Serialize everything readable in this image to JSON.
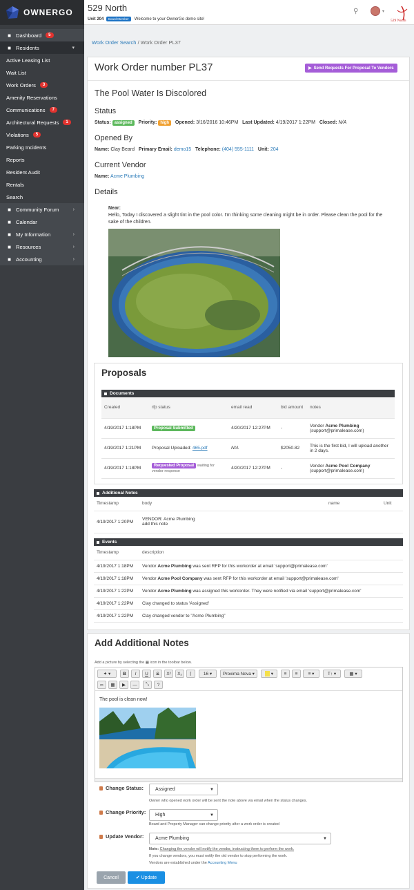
{
  "brand": {
    "name": "OWNERGO"
  },
  "sidebar": {
    "items": [
      {
        "label": "Dashboard",
        "icon": "dashboard-icon",
        "badge": "5"
      },
      {
        "label": "Residents",
        "icon": "user-icon",
        "chevron": true
      },
      {
        "label": "Active Leasing List"
      },
      {
        "label": "Wait List"
      },
      {
        "label": "Work Orders",
        "badge": "3"
      },
      {
        "label": "Amenity Reservations"
      },
      {
        "label": "Communications",
        "badge": "7"
      },
      {
        "label": "Architectural Requests",
        "badge": "1"
      },
      {
        "label": "Violations",
        "badge": "5"
      },
      {
        "label": "Parking Incidents"
      },
      {
        "label": "Reports"
      },
      {
        "label": "Resident Audit"
      },
      {
        "label": "Rentals"
      },
      {
        "label": "Search"
      },
      {
        "label": "Community Forum",
        "icon": "chat-icon",
        "chevron": true
      },
      {
        "label": "Calendar",
        "icon": "calendar-icon"
      },
      {
        "label": "My Information",
        "icon": "person-icon",
        "chevron": true
      },
      {
        "label": "Resources",
        "icon": "folder-icon",
        "chevron": true
      },
      {
        "label": "Accounting",
        "icon": "money-icon",
        "chevron": true
      }
    ]
  },
  "header": {
    "property": "529 North",
    "unit": "Unit 204",
    "role_badge": "Board Member",
    "welcome": "Welcome to your OwnerGo demo site!",
    "brand_small": "529 North"
  },
  "breadcrumb": {
    "parent": "Work Order Search",
    "sep": "/",
    "current": "Work Order PL37"
  },
  "workorder": {
    "title": "Work Order number PL37",
    "send_button": "Send Requests For Proposal To Vendors",
    "subject": "The Pool Water Is Discolored",
    "status_heading": "Status",
    "status_label": "Status:",
    "status_value": "assigned",
    "priority_label": "Priority:",
    "priority_value": "high",
    "opened_label": "Opened:",
    "opened_value": "3/16/2016 10:46PM",
    "updated_label": "Last Updated:",
    "updated_value": "4/19/2017 1:22PM",
    "closed_label": "Closed:",
    "closed_value": "N/A",
    "openedby_heading": "Opened By",
    "name_label": "Name:",
    "name_value": "Clay Beard",
    "email_label": "Primary Email:",
    "email_value": "demo15",
    "phone_label": "Telephone:",
    "phone_value": "(404) 555-1111",
    "unit_label": "Unit:",
    "unit_value": "204",
    "vendor_heading": "Current Vendor",
    "vendor_label": "Name:",
    "vendor_value": "Acme Plumbing",
    "details_heading": "Details",
    "near_label": "Near:",
    "details_text": "Hello, Today I discovered a slight tint in the pool color.  I'm thinking some cleaning might be in order.  Please clean the pool for the sake of the children."
  },
  "proposals": {
    "title": "Proposals",
    "docs_bar": "Documents",
    "columns": [
      "Created",
      "rfp status",
      "email read",
      "bid amount",
      "notes"
    ],
    "rows": [
      {
        "created": "4/19/2017 1:18PM",
        "status": "Proposal Submitted",
        "email": "4/20/2017 12:27PM",
        "bid": "-",
        "note_pre": "Vendor ",
        "note_b": "Acme Plumbing",
        "note_post": "(support@primalease.com)"
      },
      {
        "created": "4/19/2017 1:21PM",
        "status_pre": "Proposal Uploaded: ",
        "status_link": "465.pdf",
        "email": "N/A",
        "bid": "$2050.82",
        "note_post": "This is the first bid, I will upload another in 2 days."
      },
      {
        "created": "4/19/2017 1:18PM",
        "status": "Requested Proposal",
        "status_post": "waiting for vendor response",
        "email": "4/20/2017 12:27PM",
        "bid": "-",
        "note_pre": "Vendor ",
        "note_b": "Acme Pool Company",
        "note_post": "(support@primalease.com)"
      }
    ]
  },
  "additional_notes": {
    "bar": "Additional Notes",
    "columns": [
      "Timestamp",
      "body",
      "name",
      "Unit"
    ],
    "rows": [
      {
        "ts": "4/19/2017 1:20PM",
        "body1": "VENDOR: Acme Plumbing",
        "body2": "add this note"
      }
    ]
  },
  "events": {
    "bar": "Events",
    "columns": [
      "Timestamp",
      "description"
    ],
    "rows": [
      {
        "ts": "4/19/2017 1:18PM",
        "pre": "Vendor ",
        "b": "Acme Plumbing",
        "post": " was sent RFP for this workorder at email 'support@primalease.com'"
      },
      {
        "ts": "4/19/2017 1:18PM",
        "pre": "Vendor ",
        "b": "Acme Pool Company",
        "post": " was sent RFP for this workorder at email 'support@primalease.com'"
      },
      {
        "ts": "4/19/2017 1:22PM",
        "pre": "Vendor ",
        "b": "Acme Plumbing",
        "post": " was assigned this workorder. They were notified via email 'support@primalease.com'"
      },
      {
        "ts": "4/19/2017 1:22PM",
        "pre": "Clay changed to status 'Assigned'",
        "b": "",
        "post": ""
      },
      {
        "ts": "4/19/2017 1:22PM",
        "pre": "Clay changed vendor to \"Acme Plumbing\"",
        "b": "",
        "post": ""
      }
    ]
  },
  "add_notes": {
    "title": "Add Additional Notes",
    "hint_pre": "Add a picture by selecting the",
    "hint_post": "icon in the toolbar below.",
    "toolbar": {
      "font_size": "16",
      "font_family": "Proxima Nova"
    },
    "editor_text": "The pool is clean now!",
    "status_label": "Change Status:",
    "status_value": "Assigned",
    "status_help": "Owner who opened work order will be sent the note above via email when the status changes.",
    "priority_label": "Change Priority:",
    "priority_value": "High",
    "priority_help": "Board and Property Manager can change priority after a work order is created",
    "vendor_label": "Update Vendor:",
    "vendor_value": "Acme Plumbing",
    "vendor_note_b": "Note:",
    "vendor_note_u": "Changing the vendor will notify the vendor, instructing them to perform the work.",
    "vendor_note2": "If you change vendors, you must notify the old vendor to stop performing the work.",
    "vendor_note3_pre": "Vendors are established under the",
    "vendor_note3_link": "Accounting Menu",
    "cancel": "Cancel",
    "update": "Update"
  },
  "colors": {
    "sidebar": "#3a3d41",
    "accent": "#2a7ab8",
    "purple": "#a55dd8",
    "green": "#5cb85c",
    "orange": "#f0a030",
    "badge": "#e2332f",
    "update": "#1a8fe3"
  }
}
